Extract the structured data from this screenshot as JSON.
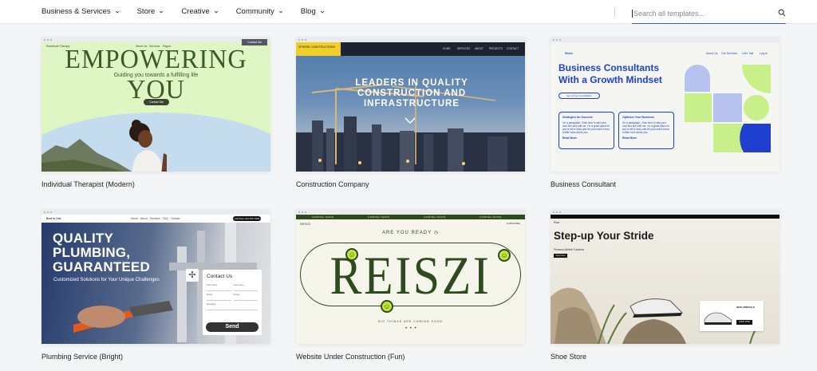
{
  "nav": {
    "items": [
      {
        "label": "Business & Services"
      },
      {
        "label": "Store"
      },
      {
        "label": "Creative"
      },
      {
        "label": "Community"
      },
      {
        "label": "Blog"
      }
    ]
  },
  "search": {
    "placeholder": "Search all templates..."
  },
  "templates": [
    {
      "title": "Individual Therapist (Modern)",
      "preview": {
        "brand": "Rosalinda Therapy",
        "nav": [
          "About Us",
          "Services",
          "Pages"
        ],
        "cta_top": "Contact Me",
        "headline": "EMPOWERING YOU",
        "subheadline": "Guiding you towards a fulfilling life",
        "button": "Contact Me"
      }
    },
    {
      "title": "Construction Company",
      "preview": {
        "brand": "SPHERE CONSTRUCTIONS",
        "nav": [
          "HOME",
          "SERVICES",
          "ABOUT",
          "PROJECTS",
          "CONTACT"
        ],
        "headline": "LEADERS IN QUALITY CONSTRUCTION AND INFRASTRUCTURE"
      }
    },
    {
      "title": "Business Consultant",
      "preview": {
        "brand": "Stuco",
        "nav": [
          "About Us",
          "Our Services",
          "Let's Talk",
          "Log In"
        ],
        "headline": "Business Consultants With a Growth Mindset",
        "button": "Get a Free Consultation",
        "box1_title": "Strategies for Success",
        "box1_text": "I'm a paragraph. Click here to add your own text and edit me. I'm a great place for you to tell a story and let your users know a little more about you.",
        "box1_link": "Read More",
        "box2_title": "Optimize Your Business",
        "box2_text": "I'm a paragraph. Click here to add your own text and edit me. I'm a great place for you to tell a story and let your users know a little more about you.",
        "box2_link": "Read More"
      }
    },
    {
      "title": "Plumbing Service (Bright)",
      "preview": {
        "brand": "Best in Line",
        "nav": [
          "Home",
          "About",
          "Services",
          "FAQ",
          "Contact"
        ],
        "phone": "Call Now 123-456-7890",
        "headline_1": "QUALITY",
        "headline_2": "PLUMBING,",
        "headline_3": "GUARANTEED",
        "subheadline": "Customized Solutions for Your Unique Challenges",
        "form_title": "Contact Us",
        "form_fields": [
          "First name",
          "Last name",
          "Email",
          "Phone",
          "Message"
        ],
        "send": "Send"
      }
    },
    {
      "title": "Website Under Construction (Fun)",
      "preview": {
        "band": [
          "COMING SOON",
          "COMING SOON",
          "COMING SOON",
          "COMING SOON"
        ],
        "logo": "REISZI",
        "sub_top": "SUBSCRIBE",
        "ready": "ARE YOU READY",
        "word": "REISZI",
        "tagline": "BIG THINGS ARE COMING SOON",
        "dots": "• • •"
      }
    },
    {
      "title": "Shoe Store",
      "preview": {
        "brand": "Run",
        "headline": "Step-up Your Stride",
        "subheadline": "Premium Athletic Footwear",
        "button": "Shop Now",
        "card_title": "NEW ARRIVALS",
        "card_button": "SHOP NOW"
      }
    }
  ],
  "colors": {
    "search_underline": "#3b5bdb",
    "therapist_bg": "#dff5c4",
    "construction_logo": "#f0cf2a",
    "consultant_blue": "#1f3fd1",
    "reiszi_green": "#2f4a1f",
    "reiszi_lime": "#c4e83a"
  }
}
